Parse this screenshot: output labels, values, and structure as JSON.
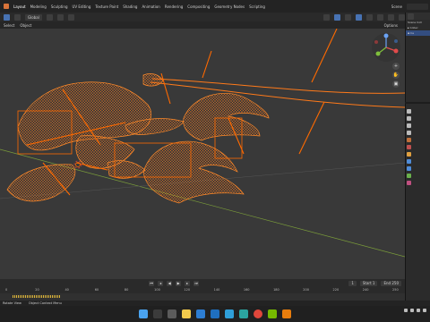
{
  "topbar": {
    "tabs": [
      "Layout",
      "Modeling",
      "Sculpting",
      "UV Editing",
      "Texture Paint",
      "Shading",
      "Animation",
      "Rendering",
      "Compositing",
      "Geometry Nodes",
      "Scripting"
    ],
    "active_tab": "Layout",
    "scene_label": "Scene"
  },
  "viewport_header": {
    "orientation": "Global",
    "menu_select": "Select",
    "menu_object": "Object",
    "options_label": "Options"
  },
  "outliner": {
    "rows": [
      "Scene Coll",
      "Collec",
      "Ca"
    ]
  },
  "timeline": {
    "frame_start_label": "Start",
    "frame_start": "1",
    "frame_end_label": "End",
    "frame_end": "250",
    "current_frame": "1",
    "ruler_ticks": [
      "0",
      "20",
      "40",
      "60",
      "80",
      "100",
      "120",
      "140",
      "160",
      "180",
      "200",
      "220",
      "240",
      "250"
    ]
  },
  "statusbar": {
    "left_text": "Rotate View",
    "mid_text": "Object Context Menu"
  },
  "colors": {
    "wire": "#ff7a1a",
    "accent": "#4772b3",
    "viewport_bg": "#393939"
  },
  "taskbar": {
    "icons": [
      "windows-start-icon",
      "search-icon",
      "task-view-icon",
      "explorer-icon",
      "store-icon",
      "mail-icon",
      "photos-icon",
      "edge-icon",
      "chrome-icon",
      "nvidia-icon",
      "blender-icon"
    ]
  }
}
